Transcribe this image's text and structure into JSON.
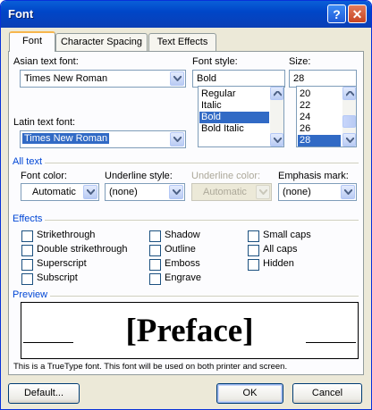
{
  "window": {
    "title": "Font",
    "help_glyph": "?",
    "close_glyph": "✕"
  },
  "tabs": [
    {
      "label": "Font"
    },
    {
      "label": "Character Spacing"
    },
    {
      "label": "Text Effects"
    }
  ],
  "fields": {
    "asian_font": {
      "label": "Asian text font:",
      "value": "Times New Roman"
    },
    "font_style": {
      "label": "Font style:",
      "value": "Bold",
      "options": [
        "Regular",
        "Italic",
        "Bold",
        "Bold Italic"
      ],
      "selected": "Bold"
    },
    "size": {
      "label": "Size:",
      "value": "28",
      "options": [
        "20",
        "22",
        "24",
        "26",
        "28"
      ],
      "selected": "28"
    },
    "latin_font": {
      "label": "Latin text font:",
      "value": "Times New Roman"
    }
  },
  "all_text": {
    "title": "All text",
    "font_color": {
      "label": "Font color:",
      "value": "Automatic"
    },
    "underline_style": {
      "label": "Underline style:",
      "value": "(none)"
    },
    "underline_color": {
      "label": "Underline color:",
      "value": "Automatic"
    },
    "emphasis_mark": {
      "label": "Emphasis mark:",
      "value": "(none)"
    }
  },
  "effects": {
    "title": "Effects",
    "items": [
      {
        "label": "Strikethrough",
        "checked": false
      },
      {
        "label": "Double strikethrough",
        "checked": false
      },
      {
        "label": "Superscript",
        "checked": false
      },
      {
        "label": "Subscript",
        "checked": false
      },
      {
        "label": "Shadow",
        "checked": false
      },
      {
        "label": "Outline",
        "checked": false
      },
      {
        "label": "Emboss",
        "checked": false
      },
      {
        "label": "Engrave",
        "checked": false
      },
      {
        "label": "Small caps",
        "checked": false
      },
      {
        "label": "All caps",
        "checked": false
      },
      {
        "label": "Hidden",
        "checked": false
      }
    ]
  },
  "preview": {
    "title": "Preview",
    "text": "[Preface]",
    "note": "This is a TrueType font. This font will be used on both printer and screen."
  },
  "buttons": {
    "default": "Default...",
    "ok": "OK",
    "cancel": "Cancel"
  },
  "colors": {
    "accent": "#0046d5",
    "selection": "#316ac5",
    "titlebar": "#0a5fd8"
  }
}
